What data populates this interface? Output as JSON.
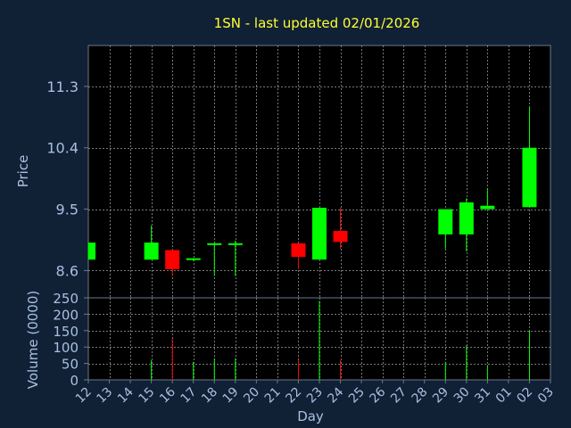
{
  "title": "1SN - last updated 02/01/2026",
  "chart_data": {
    "type": "candlestick",
    "title": "1SN - last updated 02/01/2026",
    "ylabel": "Price",
    "volume_label": "Volume (0000)",
    "xlabel": "Day",
    "ylim": [
      8.2,
      11.9
    ],
    "yticks": [
      8.6,
      9.5,
      10.4,
      11.3
    ],
    "volume_ylim": [
      0,
      250
    ],
    "volume_ticks": [
      0,
      50,
      100,
      150,
      200,
      250
    ],
    "x_labels": [
      "12",
      "13",
      "14",
      "15",
      "16",
      "17",
      "18",
      "19",
      "20",
      "21",
      "22",
      "23",
      "24",
      "25",
      "26",
      "27",
      "28",
      "29",
      "30",
      "31",
      "01",
      "02",
      "03"
    ],
    "grid": true,
    "colors": {
      "up": "#00ff00",
      "down": "#ff0000",
      "title": "#ffff33",
      "background": "#102035",
      "plot": "#000000"
    },
    "candles": [
      {
        "x": 0,
        "open": 8.76,
        "close": 9.01,
        "high": 9.01,
        "low": 8.76,
        "volume": 0
      },
      {
        "x": 3,
        "open": 8.76,
        "close": 9.01,
        "high": 9.26,
        "low": 8.76,
        "volume": 60
      },
      {
        "x": 4,
        "open": 8.9,
        "close": 8.62,
        "high": 8.9,
        "low": 8.52,
        "volume": 125
      },
      {
        "x": 5,
        "open": 8.76,
        "close": 8.78,
        "high": 8.78,
        "low": 8.74,
        "volume": 55
      },
      {
        "x": 6,
        "open": 8.98,
        "close": 9.0,
        "high": 9.0,
        "low": 8.52,
        "volume": 65
      },
      {
        "x": 7,
        "open": 8.98,
        "close": 9.0,
        "high": 9.04,
        "low": 8.52,
        "volume": 65
      },
      {
        "x": 10,
        "open": 9.0,
        "close": 8.8,
        "high": 9.0,
        "low": 8.62,
        "volume": 60
      },
      {
        "x": 11,
        "open": 8.76,
        "close": 9.52,
        "high": 9.52,
        "low": 8.76,
        "volume": 240
      },
      {
        "x": 12,
        "open": 9.18,
        "close": 9.02,
        "high": 9.52,
        "low": 8.92,
        "volume": 60
      },
      {
        "x": 17,
        "open": 9.13,
        "close": 9.5,
        "high": 9.5,
        "low": 8.92,
        "volume": 55
      },
      {
        "x": 18,
        "open": 9.13,
        "close": 9.6,
        "high": 9.66,
        "low": 8.88,
        "volume": 105
      },
      {
        "x": 19,
        "open": 9.5,
        "close": 9.55,
        "high": 9.81,
        "low": 9.5,
        "volume": 45
      },
      {
        "x": 21,
        "open": 9.53,
        "close": 10.4,
        "high": 11.0,
        "low": 9.53,
        "volume": 150
      }
    ]
  }
}
